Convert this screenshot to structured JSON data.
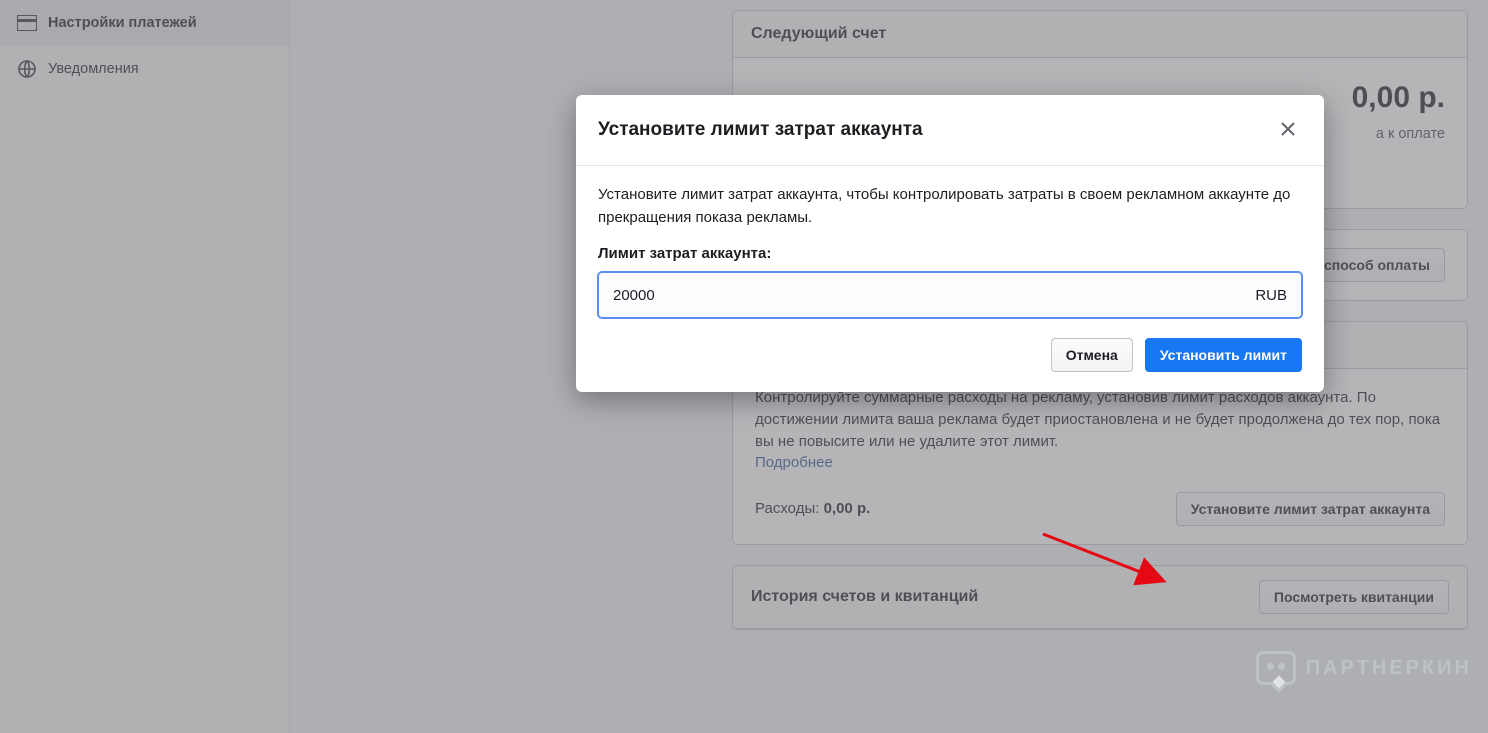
{
  "sidebar": {
    "items": [
      {
        "label": "Настройки платежей",
        "icon": "card-icon",
        "active": true
      },
      {
        "label": "Уведомления",
        "icon": "globe-icon",
        "active": false
      }
    ]
  },
  "cards": {
    "next_bill": {
      "title": "Следующий счет",
      "amount": "0,00 р.",
      "note": "а к оплате"
    },
    "pay_method": {
      "button": "способ оплаты"
    },
    "spend_limit": {
      "title": "Установите лимит затрат аккаунта",
      "desc": "Контролируйте суммарные расходы на рекламу, установив лимит расходов аккаунта. По достижении лимита ваша реклама будет приостановлена и не будет продолжена до тех пор, пока вы не повысите или не удалите этот лимит.",
      "more": "Подробнее",
      "spent_label": "Расходы:",
      "spent_value": "0,00 р.",
      "button": "Установите лимит затрат аккаунта"
    },
    "history": {
      "title": "История счетов и квитанций",
      "button": "Посмотреть квитанции"
    }
  },
  "modal": {
    "title": "Установите лимит затрат аккаунта",
    "help": "Установите лимит затрат аккаунта, чтобы контролировать затраты в своем рекламном аккаунте до прекращения показа рекламы.",
    "field_label": "Лимит затрат аккаунта:",
    "value": "20000",
    "currency": "RUB",
    "cancel": "Отмена",
    "submit": "Установить лимит"
  },
  "watermark": "ПАРТНЕРКИН"
}
